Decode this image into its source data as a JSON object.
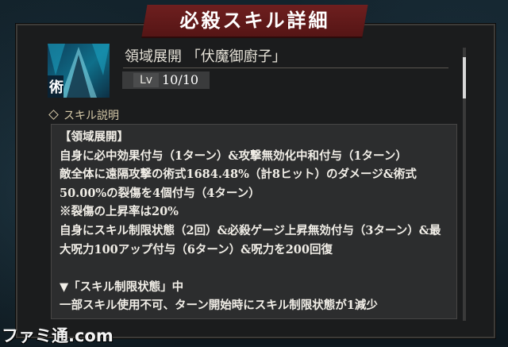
{
  "header": {
    "title": "必殺スキル詳細"
  },
  "skill": {
    "icon_name": "domain-expansion-icon",
    "icon_glyph": "術",
    "name": "領域展開 「伏魔御廚子」",
    "level_label": "Lv",
    "level_value": "10/10"
  },
  "description": {
    "heading": "スキル説明",
    "lines": [
      "【領域展開】",
      "自身に必中効果付与（1ターン）&攻撃無効化中和付与（1ターン）",
      "敵全体に遠隔攻撃の術式1684.48%（計8ヒット）のダメージ&術式",
      "50.00%の裂傷を4個付与（4ターン）",
      "※裂傷の上昇率は20%",
      "自身にスキル制限状態（2回）&必殺ゲージ上昇無効付与（3ターン）&最",
      "大呪力100アップ付与（6ターン）&呪力を200回復",
      "",
      "▼「スキル制限状態」中",
      "一部スキル使用不可、ターン開始時にスキル制限状態が1減少"
    ]
  },
  "scroll": {
    "position": 0.05
  },
  "watermark": {
    "text": "ファミ通.com"
  },
  "colors": {
    "banner": "#6e1f1f",
    "panel": "#1b1c1d",
    "text": "#f1eee7",
    "heading": "#d5c9a8"
  }
}
